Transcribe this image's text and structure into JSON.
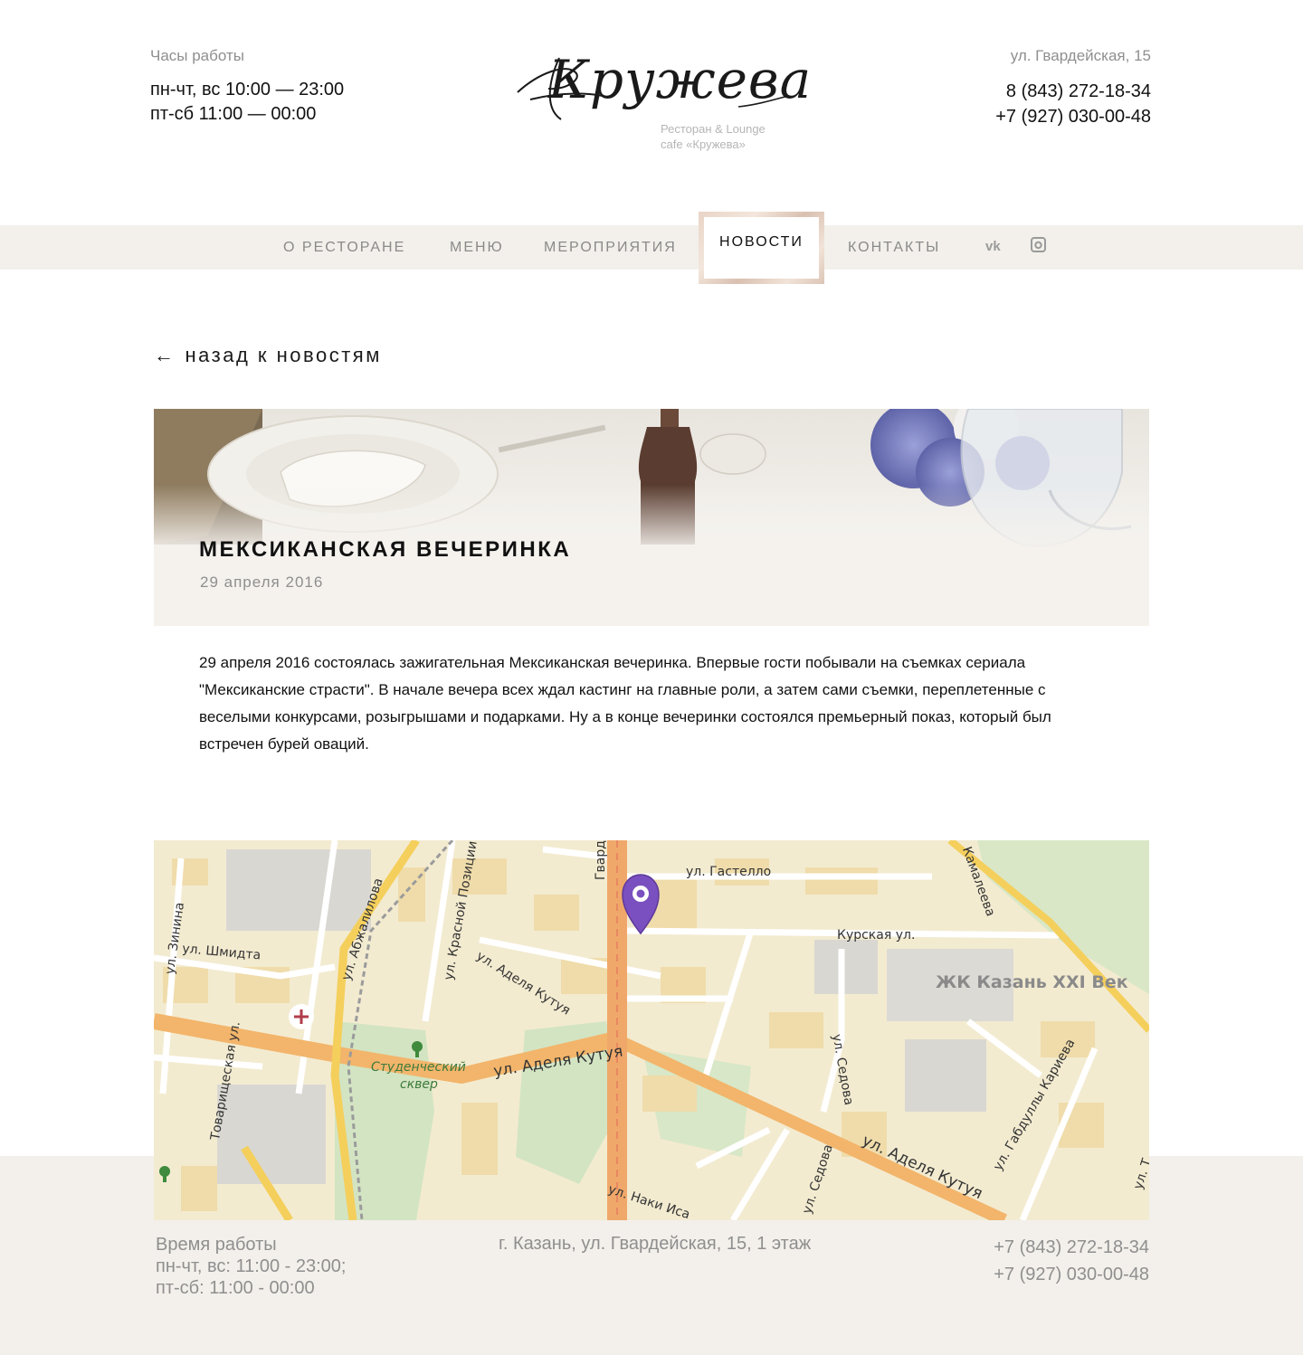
{
  "header": {
    "hours_caption": "Часы работы",
    "hours_line1": "пн-чт, вс 10:00 — 23:00",
    "hours_line2": "пт-сб 11:00 — 00:00",
    "address": "ул. Гвардейская, 15",
    "phone1": "8 (843) 272-18-34",
    "phone2": "+7 (927) 030-00-48"
  },
  "logo": {
    "wordmark": "Кружева",
    "subtitle_line1": "Ресторан & Lounge",
    "subtitle_line2": "cafe «Кружева»"
  },
  "nav": {
    "items": [
      "О РЕСТОРАНЕ",
      "МЕНЮ",
      "МЕРОПРИЯТИЯ",
      "НОВОСТИ",
      "КОНТАКТЫ"
    ],
    "active": "НОВОСТИ",
    "social": [
      {
        "icon": "vk-icon",
        "glyph": "vk"
      },
      {
        "icon": "instagram-icon",
        "glyph": "◘"
      }
    ]
  },
  "back_link": {
    "arrow": "←",
    "label": "назад к новостям"
  },
  "article": {
    "title": "МЕКСИКАНСКАЯ ВЕЧЕРИНКА",
    "date": "29 апреля 2016",
    "body_line1": "29 апреля 2016 состоялась зажигательная Мексиканская вечеринка. Впервые гости побывали на съемках сериала",
    "body_line2": "\"Мексиканские страсти\". В начале вечера всех ждал кастинг на главные роли, а затем сами съемки, переплетенные с",
    "body_line3": "веселыми конкурсами, розыгрышами и подарками. Ну а в конце вечеринки состоялся премьерный показ, который был",
    "body_line4": "встречен бурей оваций."
  },
  "map": {
    "labels": {
      "gastello": "ул. Гастелло",
      "gvardeyskaya": "Гвардейская у",
      "kurskaya": "Курская ул.",
      "kamaleeva": "Камалеева",
      "zhk": "ЖК Казань XXI Век",
      "zinina": "ул. Зинина",
      "shmidta": "ул. Шмидта",
      "abzhalilova": "ул. Абжалилова",
      "krasnoy_pozicii": "ул. Красной Позиции",
      "kutuya_north": "ул. Аделя Кутуя",
      "tovarishchevskaya": "Товарищеская ул.",
      "studencheskiy1": "Студенческий",
      "studencheskiy2": "сквер",
      "kutuya_main": "ул. Аделя Кутуя",
      "sedova": "ул. Седова",
      "kutuya_east": "ул. Аделя Кутуя",
      "karieva": "ул. Габдуллы Кариева",
      "sedova_south": "ул. Седова",
      "naki": "ул. Наки Иса",
      "edge_t": "ул. Т"
    },
    "colors": {
      "road_major": "#f2b56b",
      "road_minor": "#ffffff",
      "block": "#f1deaf",
      "green": "#cfe2bd",
      "pin": "#7a4fbf"
    }
  },
  "footer": {
    "hours_caption": "Время работы",
    "hours_line1": "пн-чт, вс: 11:00 - 23:00;",
    "hours_line2": "пт-сб: 11:00 - 00:00",
    "address": "г. Казань, ул. Гвардейская, 15, 1 этаж",
    "phone1": "+7 (843) 272-18-34",
    "phone2": "+7 (927) 030-00-48"
  }
}
